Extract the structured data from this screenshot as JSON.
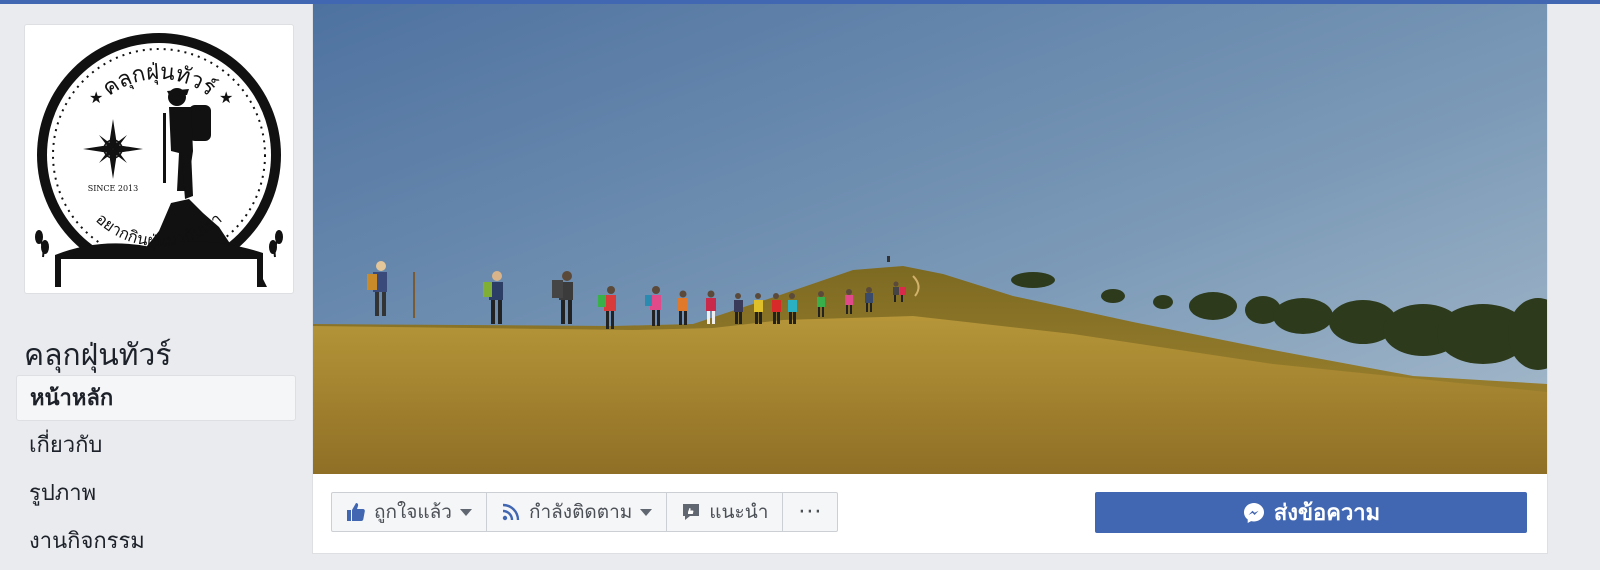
{
  "page": {
    "name": "คลุกฝุ่นทัวร์",
    "logo": {
      "arc_top": "คลุกฝุ่นทัวร์",
      "arc_bottom": "อยากกินฝุ่นมากับเรา",
      "since": "SINCE 2013"
    }
  },
  "sidebar": {
    "items": [
      {
        "label": "หน้าหลัก",
        "active": true
      },
      {
        "label": "เกี่ยวกับ"
      },
      {
        "label": "รูปภาพ"
      },
      {
        "label": "งานกิจกรรม"
      }
    ]
  },
  "actions": {
    "liked": "ถูกใจแล้ว",
    "following": "กำลังติดตาม",
    "recommend": "แนะนำ",
    "more": "···",
    "message": "ส่งข้อความ"
  },
  "colors": {
    "brand": "#4267b2",
    "background": "#e9ebee",
    "sky_top": "#4e75a3",
    "grass": "#b08e35"
  },
  "icons": [
    "thumbs-up-icon",
    "rss-icon",
    "recommend-icon",
    "more-icon",
    "messenger-icon",
    "chevron-down-icon"
  ]
}
